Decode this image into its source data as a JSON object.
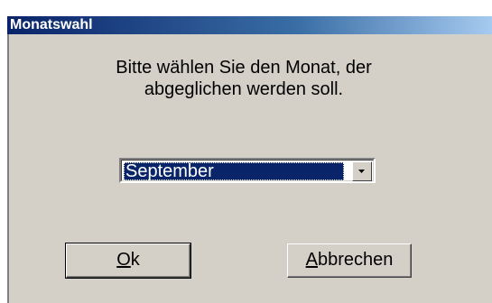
{
  "window": {
    "title": "Monatswahl"
  },
  "prompt": {
    "line1": "Bitte wählen Sie den Monat, der",
    "line2": "abgeglichen werden soll."
  },
  "month_select": {
    "selected_value": "September"
  },
  "buttons": {
    "ok": {
      "accel": "O",
      "rest": "k"
    },
    "cancel": {
      "accel": "A",
      "rest": "bbrechen"
    }
  },
  "colors": {
    "titlebar_start": "#0a246a",
    "titlebar_end": "#a6caf0",
    "dialog_face": "#d4d0c8",
    "selection": "#0a246a"
  }
}
